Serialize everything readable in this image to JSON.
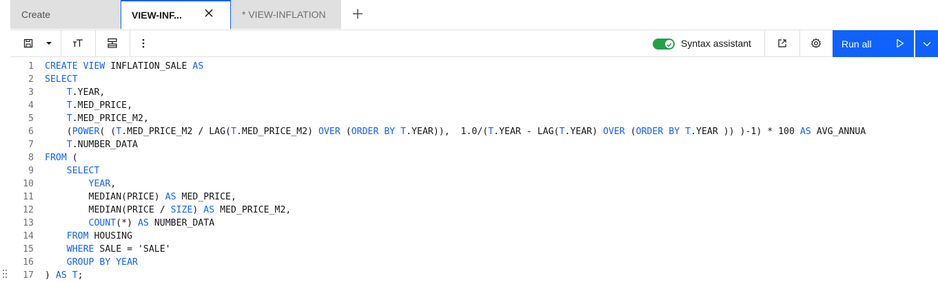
{
  "tabs": [
    {
      "label": "Create"
    },
    {
      "label": "VIEW-INF..."
    },
    {
      "label": "* VIEW-INFLATION"
    }
  ],
  "icons": {
    "close": "close-icon",
    "add": "add-icon",
    "save": "save-icon",
    "dropdown": "chevron-down-icon",
    "font": "font-size-icon",
    "format": "format-icon",
    "overflow": "overflow-menu-icon",
    "open": "launch-icon",
    "settings": "gear-icon",
    "play": "play-icon"
  },
  "toolbar": {
    "syntax_assistant_label": "Syntax assistant",
    "syntax_assistant_on": true,
    "run_all_label": "Run all"
  },
  "colors": {
    "accent": "#0f62fe",
    "toggle_on": "#24a148",
    "keyword": "#0f62fe"
  },
  "editor": {
    "lines": [
      {
        "n": "1",
        "tokens": [
          {
            "t": "CREATE VIEW",
            "k": 1
          },
          {
            "t": " INFLATION_SALE ",
            "k": 0
          },
          {
            "t": "AS",
            "k": 1
          }
        ]
      },
      {
        "n": "2",
        "tokens": [
          {
            "t": "SELECT",
            "k": 1
          }
        ]
      },
      {
        "n": "3",
        "tokens": [
          {
            "t": "    ",
            "k": 0
          },
          {
            "t": "T",
            "k": 1
          },
          {
            "t": ".YEAR,",
            "k": 0
          }
        ]
      },
      {
        "n": "4",
        "tokens": [
          {
            "t": "    ",
            "k": 0
          },
          {
            "t": "T",
            "k": 1
          },
          {
            "t": ".MED_PRICE,",
            "k": 0
          }
        ]
      },
      {
        "n": "5",
        "tokens": [
          {
            "t": "    ",
            "k": 0
          },
          {
            "t": "T",
            "k": 1
          },
          {
            "t": ".MED_PRICE_M2,",
            "k": 0
          }
        ]
      },
      {
        "n": "6",
        "tokens": [
          {
            "t": "    (",
            "k": 0
          },
          {
            "t": "POWER",
            "k": 1
          },
          {
            "t": "( (",
            "k": 0
          },
          {
            "t": "T",
            "k": 1
          },
          {
            "t": ".MED_PRICE_M2 / LAG(",
            "k": 0
          },
          {
            "t": "T",
            "k": 1
          },
          {
            "t": ".MED_PRICE_M2) ",
            "k": 0
          },
          {
            "t": "OVER",
            "k": 1
          },
          {
            "t": " (",
            "k": 0
          },
          {
            "t": "ORDER BY",
            "k": 1
          },
          {
            "t": " ",
            "k": 0
          },
          {
            "t": "T",
            "k": 1
          },
          {
            "t": ".YEAR)),  1.0/(",
            "k": 0
          },
          {
            "t": "T",
            "k": 1
          },
          {
            "t": ".YEAR - LAG(",
            "k": 0
          },
          {
            "t": "T",
            "k": 1
          },
          {
            "t": ".YEAR) ",
            "k": 0
          },
          {
            "t": "OVER",
            "k": 1
          },
          {
            "t": " (",
            "k": 0
          },
          {
            "t": "ORDER BY",
            "k": 1
          },
          {
            "t": " ",
            "k": 0
          },
          {
            "t": "T",
            "k": 1
          },
          {
            "t": ".YEAR )) )-1) * 100 ",
            "k": 0
          },
          {
            "t": "AS",
            "k": 1
          },
          {
            "t": " AVG_ANNUA",
            "k": 0
          }
        ]
      },
      {
        "n": "7",
        "tokens": [
          {
            "t": "    ",
            "k": 0
          },
          {
            "t": "T",
            "k": 1
          },
          {
            "t": ".NUMBER_DATA",
            "k": 0
          }
        ]
      },
      {
        "n": "8",
        "tokens": [
          {
            "t": "FROM",
            "k": 1
          },
          {
            "t": " (",
            "k": 0
          }
        ]
      },
      {
        "n": "9",
        "tokens": [
          {
            "t": "    ",
            "k": 0
          },
          {
            "t": "SELECT",
            "k": 1
          }
        ]
      },
      {
        "n": "10",
        "tokens": [
          {
            "t": "        ",
            "k": 0
          },
          {
            "t": "YEAR",
            "k": 1
          },
          {
            "t": ",",
            "k": 0
          }
        ]
      },
      {
        "n": "11",
        "tokens": [
          {
            "t": "        MEDIAN(PRICE) ",
            "k": 0
          },
          {
            "t": "AS",
            "k": 1
          },
          {
            "t": " MED_PRICE,",
            "k": 0
          }
        ]
      },
      {
        "n": "12",
        "tokens": [
          {
            "t": "        MEDIAN(PRICE / ",
            "k": 0
          },
          {
            "t": "SIZE",
            "k": 1
          },
          {
            "t": ") ",
            "k": 0
          },
          {
            "t": "AS",
            "k": 1
          },
          {
            "t": " MED_PRICE_M2,",
            "k": 0
          }
        ]
      },
      {
        "n": "13",
        "tokens": [
          {
            "t": "        ",
            "k": 0
          },
          {
            "t": "COUNT",
            "k": 1
          },
          {
            "t": "(*) ",
            "k": 0
          },
          {
            "t": "AS",
            "k": 1
          },
          {
            "t": " NUMBER_DATA",
            "k": 0
          }
        ]
      },
      {
        "n": "14",
        "tokens": [
          {
            "t": "    ",
            "k": 0
          },
          {
            "t": "FROM",
            "k": 1
          },
          {
            "t": " HOUSING",
            "k": 0
          }
        ]
      },
      {
        "n": "15",
        "tokens": [
          {
            "t": "    ",
            "k": 0
          },
          {
            "t": "WHERE",
            "k": 1
          },
          {
            "t": " SALE = 'SALE'",
            "k": 0
          }
        ]
      },
      {
        "n": "16",
        "tokens": [
          {
            "t": "    ",
            "k": 0
          },
          {
            "t": "GROUP BY YEAR",
            "k": 1
          }
        ]
      },
      {
        "n": "17",
        "tokens": [
          {
            "t": ") ",
            "k": 0
          },
          {
            "t": "AS T",
            "k": 1
          },
          {
            "t": ";",
            "k": 0
          }
        ]
      }
    ]
  }
}
